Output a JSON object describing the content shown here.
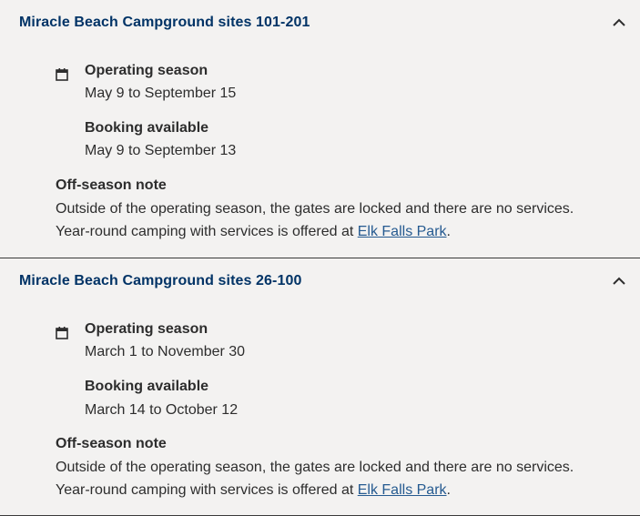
{
  "sections": [
    {
      "title": "Miracle Beach Campground sites 101-201",
      "operating_label": "Operating season",
      "operating_dates": "May 9 to September 15",
      "booking_label": "Booking available",
      "booking_dates": "May 9 to September 13",
      "note_label": "Off-season note",
      "note_line1": "Outside of the operating season, the gates are locked and there are no services.",
      "note_line2_prefix": "Year-round camping with services is offered at ",
      "note_link": "Elk Falls Park",
      "note_line2_suffix": "."
    },
    {
      "title": "Miracle Beach Campground sites 26-100",
      "operating_label": "Operating season",
      "operating_dates": "March 1 to November 30",
      "booking_label": "Booking available",
      "booking_dates": "March 14 to October 12",
      "note_label": "Off-season note",
      "note_line1": "Outside of the operating season, the gates are locked and there are no services.",
      "note_line2_prefix": "Year-round camping with services is offered at ",
      "note_link": "Elk Falls Park",
      "note_line2_suffix": "."
    }
  ],
  "colors": {
    "background": "#f3f2f1",
    "title": "#013366",
    "text": "#2d2d2d",
    "link": "#255a90",
    "divider": "#3a3a3a"
  },
  "icons": {
    "expand": "chevron-up-icon",
    "date": "calendar-icon"
  }
}
